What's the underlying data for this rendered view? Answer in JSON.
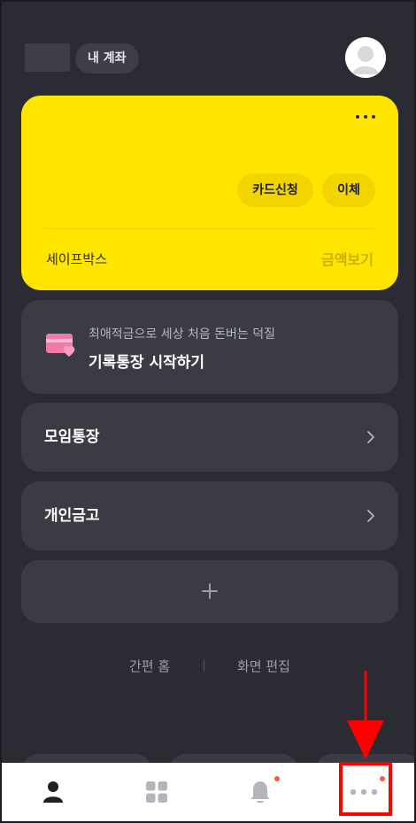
{
  "header": {
    "my_account_label": "내 계좌"
  },
  "main_card": {
    "card_apply_label": "카드신청",
    "transfer_label": "이체",
    "safebox_label": "세이프박스",
    "view_amount_label": "금액보기"
  },
  "promo": {
    "subtitle": "최애적금으로 세상 처음 돈버는 덕질",
    "title": "기록통장 시작하기"
  },
  "rows": {
    "group_account": "모임통장",
    "personal_safe": "개인금고"
  },
  "footer_links": {
    "easy_home": "간편 홈",
    "edit_screen": "화면 편집"
  },
  "bottom_nav": {
    "items": [
      {
        "icon": "person-icon",
        "active": true
      },
      {
        "icon": "grid-icon",
        "active": false
      },
      {
        "icon": "bell-icon",
        "active": false,
        "badge": true
      },
      {
        "icon": "more-icon",
        "active": false,
        "badge": true
      }
    ]
  },
  "colors": {
    "background": "#2a2b33",
    "card_dark": "#3a3b45",
    "main_card_yellow": "#ffe500",
    "badge": "#ff5a3c",
    "annotation_red": "#ff0000"
  }
}
